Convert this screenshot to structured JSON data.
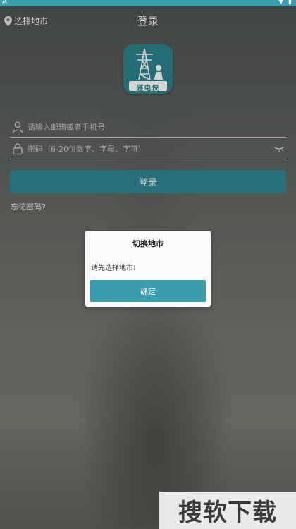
{
  "status_bar": {
    "left_glyph": "A",
    "icons": [
      "wifi-icon",
      "battery-icon"
    ]
  },
  "header": {
    "city_label": "选择地市",
    "title": "登录"
  },
  "logo": {
    "label": "碰电侠"
  },
  "form": {
    "account_placeholder": "请输入邮箱或者手机号",
    "password_placeholder": "密码（6-20位数字、字母、字符）",
    "login_label": "登录",
    "forgot_label": "忘记密码?"
  },
  "dialog": {
    "title": "切换地市",
    "message": "请先选择地市!",
    "confirm_label": "确定"
  },
  "watermark": {
    "text": "搜软下载"
  },
  "colors": {
    "accent": "#3a9cae",
    "button": "#2f7f8f",
    "status_bar": "#3a9fb2"
  }
}
